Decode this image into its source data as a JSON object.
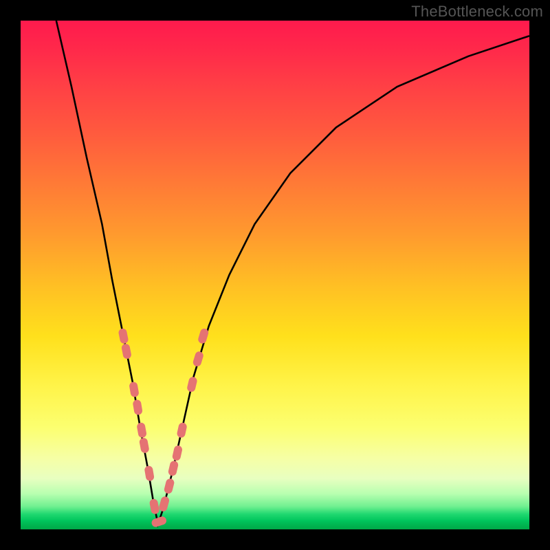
{
  "watermark": "TheBottleneck.com",
  "colors": {
    "frame": "#000000",
    "curve": "#000000",
    "marker": "#e57373",
    "gradient_top": "#ff1a4d",
    "gradient_bottom": "#00a848"
  },
  "chart_data": {
    "type": "line",
    "title": "",
    "xlabel": "",
    "ylabel": "",
    "xlim": [
      0,
      100
    ],
    "ylim": [
      0,
      100
    ],
    "grid": false,
    "legend": false,
    "description": "Bottleneck V-curve over vertical performance gradient (red=high bottleneck, green=low). Curve minimum at x≈27 touches y≈0.",
    "series": [
      {
        "name": "bottleneck-curve",
        "x": [
          7,
          10,
          13,
          16,
          18,
          20,
          22,
          23.5,
          25,
          26,
          27,
          28,
          30,
          32,
          34,
          37,
          41,
          46,
          53,
          62,
          74,
          88,
          100
        ],
        "y": [
          100,
          87,
          73,
          60,
          49,
          39,
          29,
          20,
          12,
          6,
          1,
          4,
          12,
          21,
          30,
          40,
          50,
          60,
          70,
          79,
          87,
          93,
          97
        ]
      }
    ],
    "markers": {
      "name": "highlighted-points",
      "x_approx": [
        20.2,
        20.8,
        22.3,
        23.0,
        23.8,
        24.3,
        25.3,
        26.3,
        27.2,
        28.2,
        29.2,
        30.0,
        30.8,
        31.7,
        33.7,
        34.9,
        35.9
      ],
      "y_approx": [
        38,
        35,
        27.5,
        24,
        19.5,
        16.5,
        11,
        4.5,
        1.5,
        5,
        8.5,
        12,
        15,
        19.5,
        28.5,
        33.5,
        38
      ]
    }
  }
}
